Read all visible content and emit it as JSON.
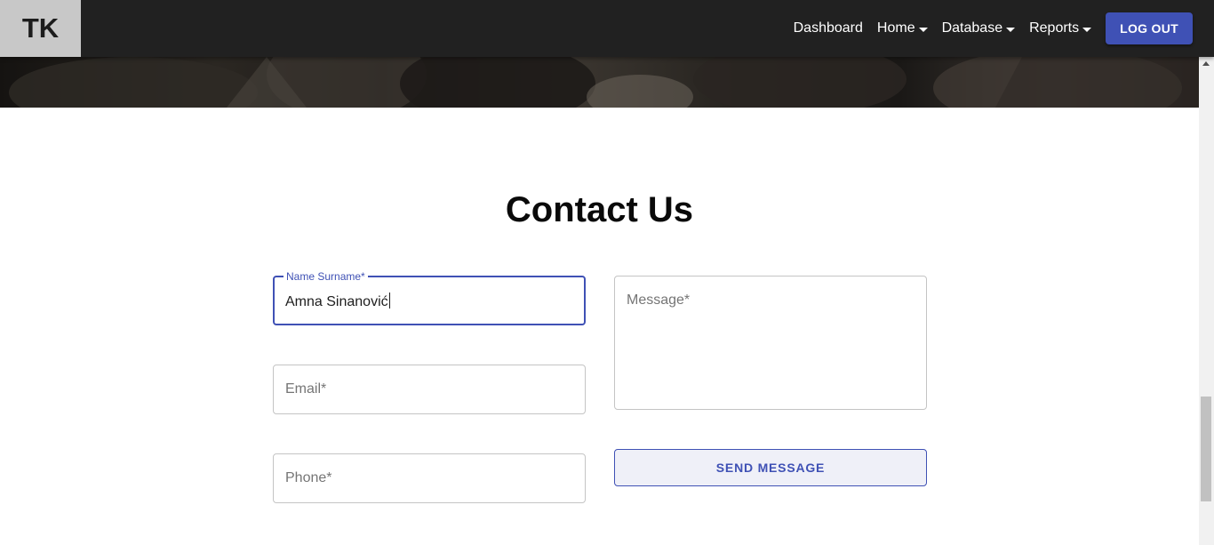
{
  "brand": {
    "logo_text": "TK"
  },
  "nav": {
    "items": [
      {
        "label": "Dashboard",
        "has_dropdown": false
      },
      {
        "label": "Home",
        "has_dropdown": true
      },
      {
        "label": "Database",
        "has_dropdown": true
      },
      {
        "label": "Reports",
        "has_dropdown": true
      }
    ],
    "logout_label": "LOG OUT"
  },
  "contact": {
    "title": "Contact Us",
    "name_field": {
      "label": "Name Surname*",
      "value": "Amna Sinanović"
    },
    "email_field": {
      "placeholder": "Email*"
    },
    "phone_field": {
      "placeholder": "Phone*"
    },
    "message_field": {
      "placeholder": "Message*"
    },
    "send_label": "SEND MESSAGE"
  },
  "colors": {
    "navbar": "#212121",
    "accent": "#3f51b5",
    "logo_bg": "#c8c8c8"
  }
}
